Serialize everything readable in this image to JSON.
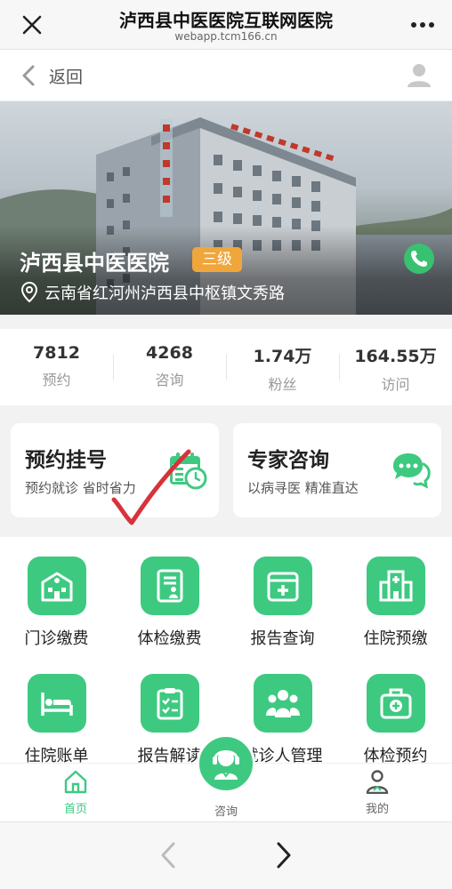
{
  "browser": {
    "title": "泸西县中医医院互联网医院",
    "url": "webapp.tcm166.cn"
  },
  "nav": {
    "back_label": "返回"
  },
  "hospital": {
    "name": "泸西县中医医院",
    "level": "三级",
    "address": "云南省红河州泸西县中枢镇文秀路"
  },
  "stats": [
    {
      "value": "7812",
      "label": "预约"
    },
    {
      "value": "4268",
      "label": "咨询"
    },
    {
      "value": "1.74万",
      "label": "粉丝"
    },
    {
      "value": "164.55万",
      "label": "访问"
    }
  ],
  "cards": [
    {
      "title": "预约挂号",
      "subtitle": "预约就诊 省时省力",
      "icon": "calendar-clock-icon"
    },
    {
      "title": "专家咨询",
      "subtitle": "以病寻医 精准直达",
      "icon": "chat-bubbles-icon"
    }
  ],
  "grid": [
    {
      "label": "门诊缴费",
      "icon": "hospital-icon"
    },
    {
      "label": "体检缴费",
      "icon": "document-person-icon"
    },
    {
      "label": "报告查询",
      "icon": "medical-kit-icon"
    },
    {
      "label": "住院预缴",
      "icon": "building-icon"
    },
    {
      "label": "住院账单",
      "icon": "bed-icon"
    },
    {
      "label": "报告解读",
      "icon": "clipboard-icon"
    },
    {
      "label": "就诊人管理",
      "icon": "people-icon"
    },
    {
      "label": "体检预约",
      "icon": "first-aid-box-icon"
    }
  ],
  "tabs": {
    "home": "首页",
    "consult": "咨询",
    "me": "我的"
  },
  "colors": {
    "primary_green": "#3ec981",
    "badge_orange": "#f0a63a",
    "check_red": "#d8323a"
  }
}
